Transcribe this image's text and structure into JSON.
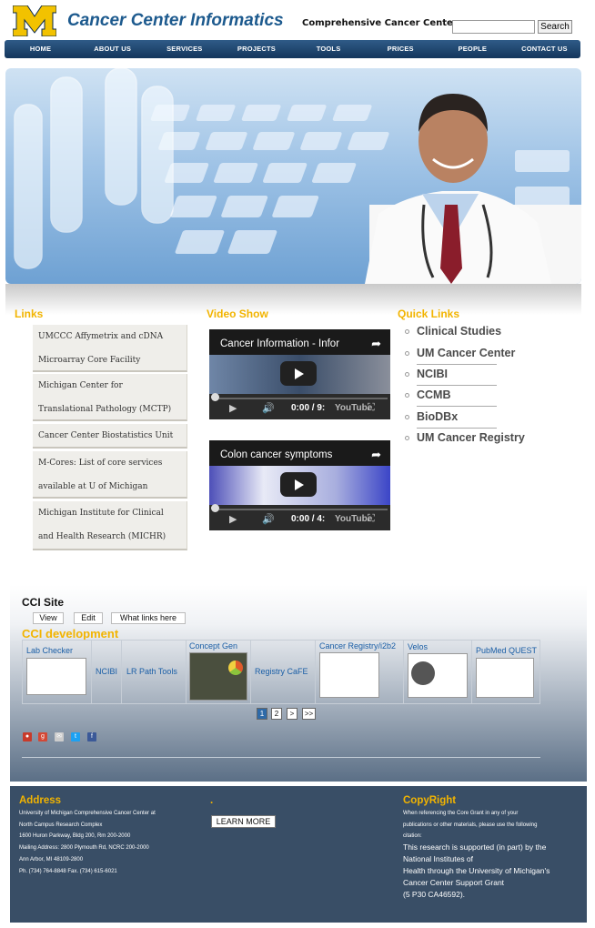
{
  "header": {
    "title": "Cancer Center Informatics",
    "subtitle": "Comprehensive Cancer Center",
    "search_button": "Search",
    "search_value": ""
  },
  "nav": {
    "items": [
      "HOME",
      "ABOUT US",
      "SERVICES",
      "PROJECTS",
      "TOOLS",
      "PRICES",
      "PEOPLE",
      "CONTACT US"
    ]
  },
  "links": {
    "title": "Links",
    "items": [
      {
        "line1": "UMCCC Affymetrix and cDNA",
        "line2": "Microarray Core Facility"
      },
      {
        "line1": "Michigan Center for",
        "line2": "Translational Pathology (MCTP)"
      },
      {
        "line1": "Cancer Center Biostatistics Unit",
        "line2": ""
      },
      {
        "line1": "M-Cores: List of core services",
        "line2": "available at U of Michigan"
      },
      {
        "line1": "Michigan Institute for Clinical",
        "line2": "and Health Research (MICHR)"
      }
    ]
  },
  "video_show": {
    "title": "Video Show",
    "videos": [
      {
        "title": "Cancer Information - Infor",
        "time": "0:00 / 9:",
        "logo": "YouTube"
      },
      {
        "title": "Colon cancer symptoms",
        "time": "0:00 / 4:",
        "logo": "YouTube"
      }
    ]
  },
  "quick_links": {
    "title": "Quick Links",
    "items": [
      "Clinical Studies",
      "UM Cancer Center",
      "NCIBI",
      "CCMB",
      "BioDBx",
      "UM Cancer Registry"
    ]
  },
  "cci_site": {
    "title": "CCI Site",
    "tabs": [
      "View",
      "Edit",
      "What links here"
    ],
    "section_title": "CCI development",
    "tiles": [
      "Lab Checker",
      "NCIBI",
      "LR Path Tools",
      "Concept Gen",
      "Registry CaFE",
      "Cancer Registry/i2b2",
      "Velos",
      "PubMed QUEST"
    ],
    "pager": [
      "1",
      "2",
      ">",
      ">>"
    ]
  },
  "footer": {
    "address_title": "Address",
    "address_lines": [
      "University of Michigan Comprehensive Cancer Center at",
      "North Campus Research Complex",
      "1600 Huron Parkway, Bldg 200, Rm 200-2000",
      "Mailing Address: 2800 Plymouth Rd, NCRC 200-2000",
      "Ann Arbor, MI 48109-2800",
      "Ph. (734) 764-8848 Fax. (734) 615-6021"
    ],
    "middle_title": ".",
    "learn_more": "LEARN MORE",
    "copyright_title": "CopyRight",
    "copyright_small": [
      "When referencing the Core Grant in any of your",
      "publications or other materials, please use the following",
      "citation:"
    ],
    "copyright_lines": [
      "This research is supported (in part) by the",
      "National Institutes of",
      "Health through the University of Michigan's",
      "Cancer Center Support Grant",
      "(5 P30 CA46592)."
    ]
  },
  "colors": {
    "accent_yellow": "#f2b400",
    "nav_blue": "#1d4470",
    "title_blue": "#1d5a8e",
    "footer_bg": "#394e66"
  }
}
